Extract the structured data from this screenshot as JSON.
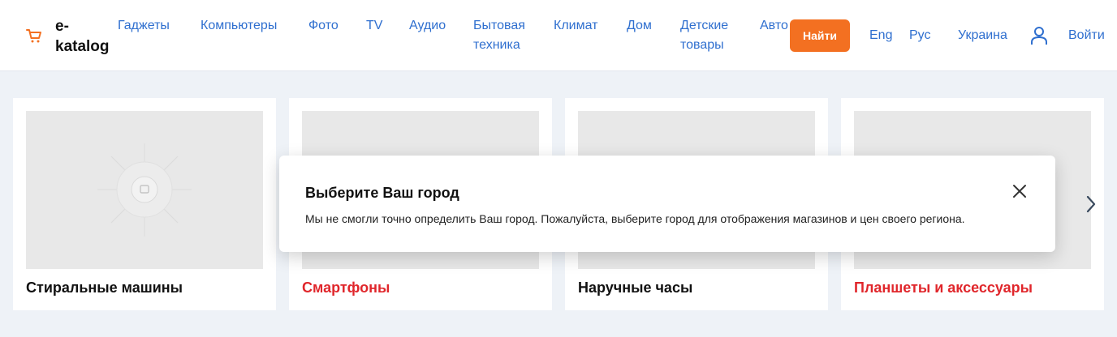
{
  "header": {
    "logo_text": "e-\nkatalog",
    "nav": [
      "Гаджеты",
      "Компьютеры",
      "Фото",
      "TV",
      "Аудио",
      "Бытовая техника",
      "Климат",
      "Дом",
      "Детские товары",
      "Авто"
    ],
    "search_button": "Найти",
    "lang_en": "Eng",
    "lang_ru": "Рус",
    "region": "Украина",
    "login": "Войти"
  },
  "cards": [
    {
      "title": "Стиральные машины"
    },
    {
      "title": "Смартфоны"
    },
    {
      "title": "Наручные часы"
    },
    {
      "title": "Планшеты и аксессуары"
    }
  ],
  "modal": {
    "title": "Выберите Ваш город",
    "text": "Мы не смогли точно определить Ваш город. Пожалуйста, выберите город для отображения магазинов и цен своего региона."
  },
  "colors": {
    "accent": "#f37021",
    "link": "#2f6fcf",
    "highlight_title": "#e0262b"
  },
  "icons": [
    "cart-icon",
    "user-icon",
    "close-icon",
    "chevron-left-icon",
    "chevron-right-icon",
    "image-placeholder-icon"
  ]
}
